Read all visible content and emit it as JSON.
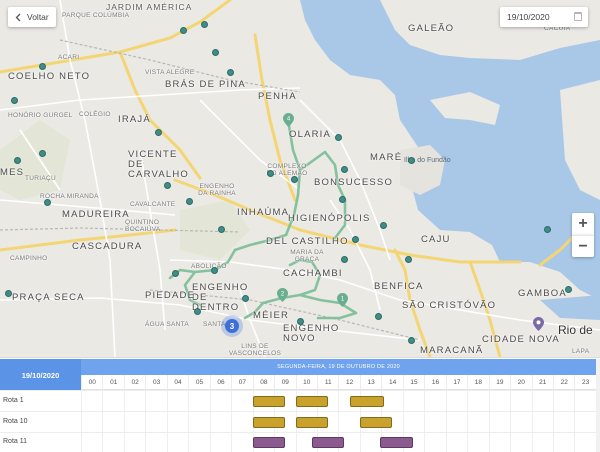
{
  "controls": {
    "back_label": "Voltar",
    "date_value": "19/10/2020",
    "zoom_in": "+",
    "zoom_out": "−"
  },
  "map": {
    "neighborhoods_big": [
      "COELHO NETO",
      "BRÁS DE PINA",
      "PENHA",
      "OLARIA",
      "IRAJÁ",
      "VICENTE DE CARVALHO",
      "MADUREIRA",
      "CASCADURA",
      "BONSUCESSO",
      "MARÉ",
      "INHAÚMA",
      "HIGIENÓPOLIS",
      "DEL CASTILHO",
      "CAJU",
      "CACHAMBI",
      "ENGENHO DE DENTRO",
      "PIEDADE",
      "PRAÇA SECA",
      "MÉIER",
      "ENGENHO NOVO",
      "BENFICA",
      "SÃO CRISTÓVÃO",
      "GAMBOA",
      "CIDADE NOVA",
      "MARACANÃ",
      "GALEÃO",
      "MES"
    ],
    "neighborhoods_small": [
      "JARDIM AMÉRICA",
      "PARQUE COLÚMBIA",
      "ACARI",
      "VISTA ALEGRE",
      "HONÓRIO GURGEL",
      "COLÉGIO",
      "TURIAÇU",
      "ROCHA MIRANDA",
      "COMPLEXO DO ALEMÃO",
      "ENGENHO DA RAINHA",
      "CAVALCANTE",
      "QUINTINO BOCAIÚVA",
      "CAMPINHO",
      "ABOLIÇÃO",
      "MARIA DA GRAÇA",
      "ÁGUA SANTA",
      "SANTA",
      "LINS DE VASCONCELOS",
      "CACUIA",
      "LAPA"
    ],
    "water_labels": [
      "Ilha do Fundão"
    ],
    "city_label": "Rio de",
    "cluster_count": "3",
    "route_pins": [
      "4",
      "2",
      "1"
    ]
  },
  "timeline": {
    "selected_date": "19/10/2020",
    "day_header": "SEGUNDA-FEIRA, 19 DE OUTUBRO DE 2020",
    "hours": [
      "00",
      "01",
      "02",
      "03",
      "04",
      "05",
      "06",
      "07",
      "08",
      "09",
      "10",
      "11",
      "12",
      "13",
      "14",
      "15",
      "16",
      "17",
      "18",
      "19",
      "20",
      "21",
      "22",
      "23"
    ],
    "rows": [
      {
        "label": "Rota 1",
        "color": "#c8a22a",
        "events": [
          {
            "start": 8.0,
            "end": 9.5
          },
          {
            "start": 10.0,
            "end": 11.5
          },
          {
            "start": 12.55,
            "end": 14.1
          }
        ]
      },
      {
        "label": "Rota 10",
        "color": "#c8a22a",
        "events": [
          {
            "start": 8.0,
            "end": 9.5
          },
          {
            "start": 10.0,
            "end": 11.5
          },
          {
            "start": 13.0,
            "end": 14.5
          }
        ]
      },
      {
        "label": "Rota 11",
        "color": "#8b5a8f",
        "events": [
          {
            "start": 8.0,
            "end": 9.5
          },
          {
            "start": 10.75,
            "end": 12.25
          },
          {
            "start": 13.95,
            "end": 15.45
          }
        ]
      }
    ]
  },
  "colors": {
    "route_line": "#7fbf9a",
    "marker": "#3f8d86",
    "header_blue": "#5b93e6",
    "water": "#a9c8e8"
  }
}
